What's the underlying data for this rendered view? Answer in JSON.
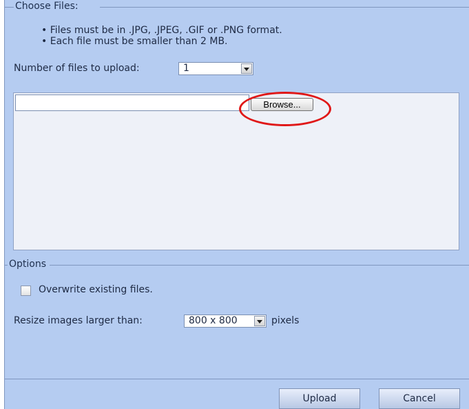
{
  "choose_files": {
    "legend": "Choose Files:",
    "rules": [
      "Files must be in .JPG, .JPEG, .GIF or .PNG format.",
      "Each file must be smaller than 2 MB."
    ],
    "num_files_label": "Number of files to upload:",
    "num_files_value": "1",
    "file_input_value": "",
    "browse_label": "Browse..."
  },
  "options": {
    "legend": "Options",
    "overwrite_label": "Overwrite existing files.",
    "overwrite_checked": false,
    "resize_label": "Resize images larger than:",
    "resize_value": "800 x 800",
    "pixels_label": "pixels"
  },
  "actions": {
    "upload_label": "Upload",
    "cancel_label": "Cancel"
  },
  "annotation": {
    "highlight_color": "#e01818",
    "target": "browse-button"
  }
}
